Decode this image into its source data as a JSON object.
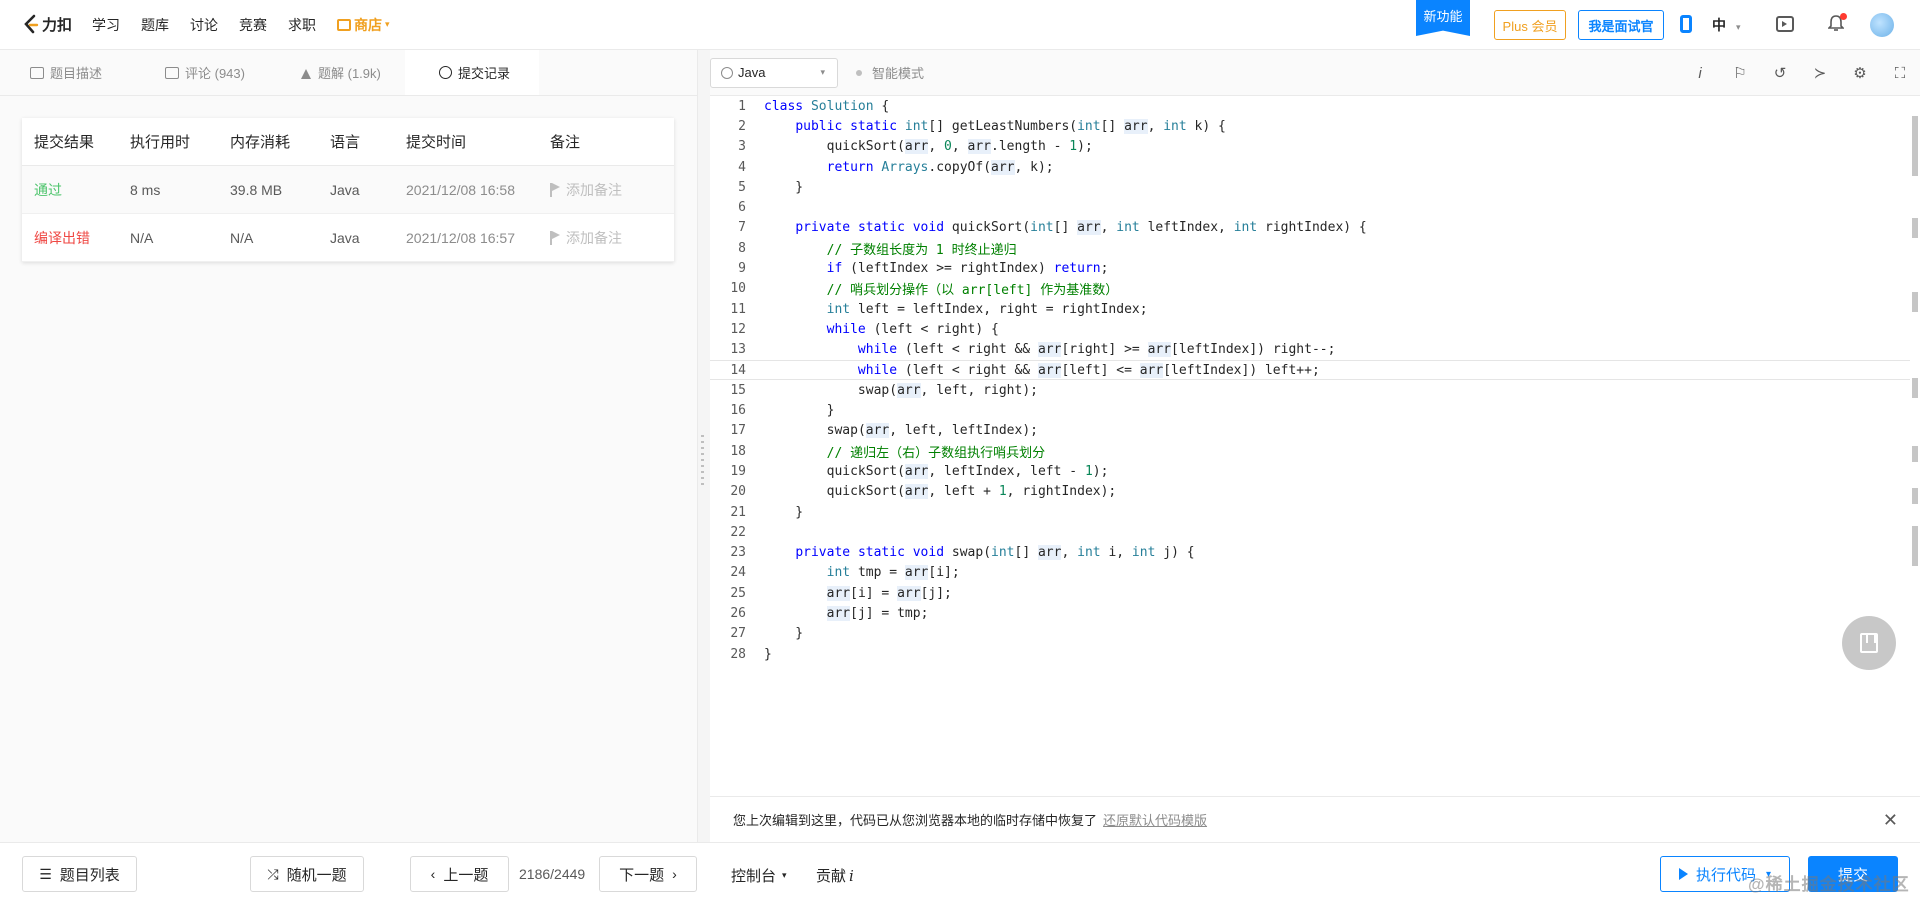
{
  "nav": {
    "logo_text": "力扣",
    "links": [
      "学习",
      "题库",
      "讨论",
      "竞赛",
      "求职"
    ],
    "store": "商店",
    "new_feature": "新功能",
    "plus_member": "Plus 会员",
    "interviewer": "我是面试官",
    "language": "中"
  },
  "tabs": [
    {
      "label": "题目描述",
      "icon": "description-icon"
    },
    {
      "label": "评论 (943)",
      "icon": "comment-icon"
    },
    {
      "label": "题解 (1.9k)",
      "icon": "flask-icon"
    },
    {
      "label": "提交记录",
      "icon": "clock-icon"
    }
  ],
  "submissions": {
    "headers": [
      "提交结果",
      "执行用时",
      "内存消耗",
      "语言",
      "提交时间",
      "备注"
    ],
    "rows": [
      {
        "result": "通过",
        "time": "8 ms",
        "memory": "39.8 MB",
        "lang": "Java",
        "submitted": "2021/12/08 16:58",
        "note": "添加备注"
      },
      {
        "result": "编译出错",
        "time": "N/A",
        "memory": "N/A",
        "lang": "Java",
        "submitted": "2021/12/08 16:57",
        "note": "添加备注"
      }
    ]
  },
  "editor": {
    "language": "Java",
    "smart_mode": "智能模式",
    "restore_message": "您上次编辑到这里，代码已从您浏览器本地的临时存储中恢复了",
    "restore_link": "还原默认代码模版"
  },
  "code_lines": [
    "class Solution {",
    "    public static int[] getLeastNumbers(int[] arr, int k) {",
    "        quickSort(arr, 0, arr.length - 1);",
    "        return Arrays.copyOf(arr, k);",
    "    }",
    "",
    "    private static void quickSort(int[] arr, int leftIndex, int rightIndex) {",
    "        // 子数组长度为 1 时终止递归",
    "        if (leftIndex >= rightIndex) return;",
    "        // 哨兵划分操作（以 arr[left] 作为基准数）",
    "        int left = leftIndex, right = rightIndex;",
    "        while (left < right) {",
    "            while (left < right && arr[right] >= arr[leftIndex]) right--;",
    "            while (left < right && arr[left] <= arr[leftIndex]) left++;",
    "            swap(arr, left, right);",
    "        }",
    "        swap(arr, left, leftIndex);",
    "        // 递归左（右）子数组执行哨兵划分",
    "        quickSort(arr, leftIndex, left - 1);",
    "        quickSort(arr, left + 1, rightIndex);",
    "    }",
    "",
    "    private static void swap(int[] arr, int i, int j) {",
    "        int tmp = arr[i];",
    "        arr[i] = arr[j];",
    "        arr[j] = tmp;",
    "    }",
    "}"
  ],
  "bottom": {
    "problem_list": "题目列表",
    "random": "随机一题",
    "prev": "上一题",
    "counter": "2186/2449",
    "next": "下一题",
    "console": "控制台",
    "contribute": "贡献",
    "run": "执行代码",
    "submit": "提交"
  },
  "watermark": "@稀土掘金技术社区",
  "colors": {
    "accent": "#0a84ff",
    "pass": "#4dc46c",
    "error": "#ef4743",
    "store": "#f0a020"
  }
}
